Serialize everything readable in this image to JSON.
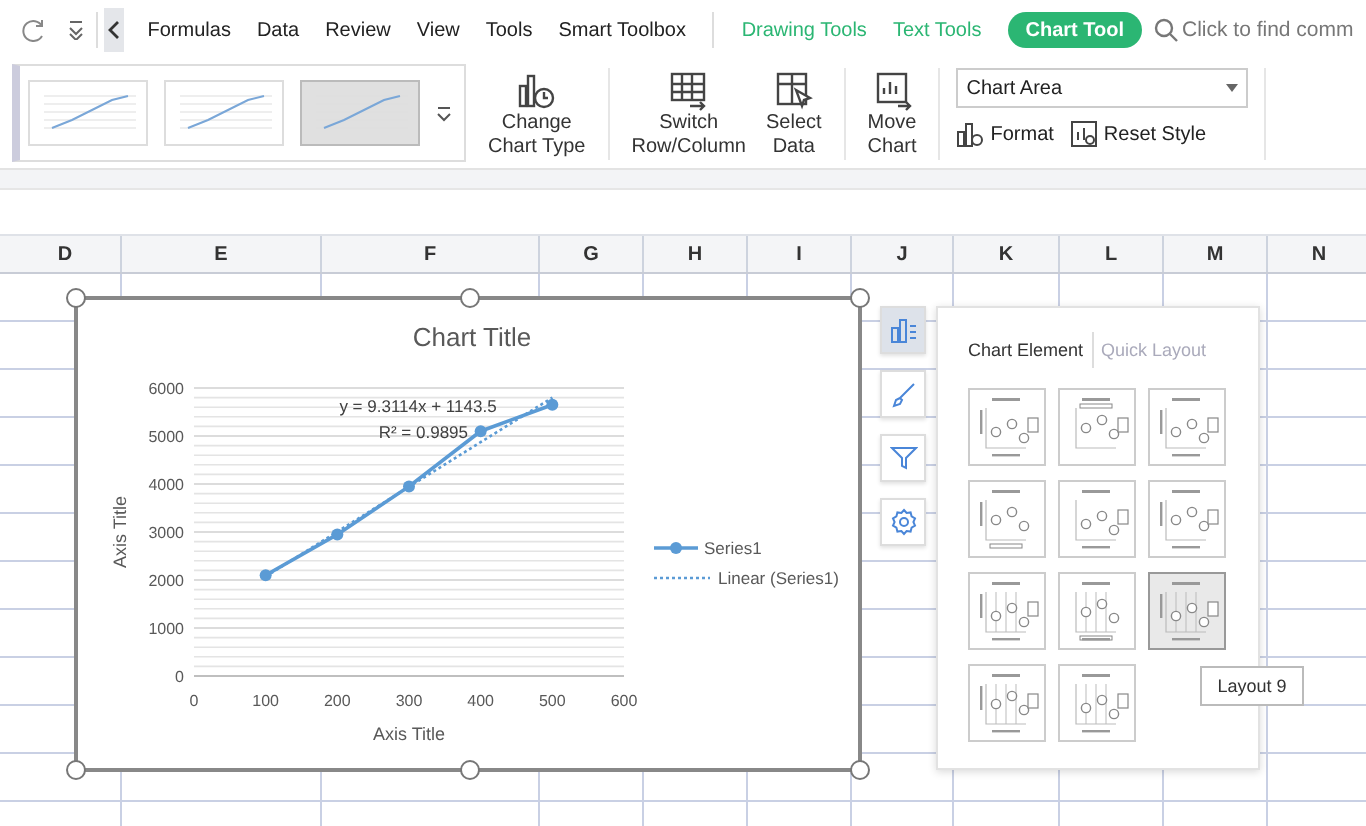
{
  "toolbar": {
    "tabs": [
      {
        "label": "Formulas",
        "kind": "menu",
        "selected": false
      },
      {
        "label": "Data",
        "kind": "menu",
        "selected": false
      },
      {
        "label": "Review",
        "kind": "menu",
        "selected": false
      },
      {
        "label": "View",
        "kind": "menu",
        "selected": false
      },
      {
        "label": "Tools",
        "kind": "menu",
        "selected": false
      },
      {
        "label": "Smart Toolbox",
        "kind": "menu",
        "selected": false
      },
      {
        "label": "Drawing Tools",
        "kind": "context",
        "selected": false
      },
      {
        "label": "Text Tools",
        "kind": "context",
        "selected": false
      },
      {
        "label": "Chart Tool",
        "kind": "context",
        "selected": true
      }
    ],
    "search": {
      "placeholder": "Click to find comm"
    }
  },
  "ribbon": {
    "chart_styles": [
      {
        "selected": false
      },
      {
        "selected": false
      },
      {
        "selected": true
      }
    ],
    "buttons": [
      {
        "kind": "change-type",
        "lines": [
          "Change",
          "Chart Type"
        ]
      },
      {
        "kind": "switch",
        "lines": [
          "Switch",
          "Row/Column"
        ]
      },
      {
        "kind": "select-data",
        "lines": [
          "Select",
          "Data"
        ]
      },
      {
        "kind": "move",
        "lines": [
          "Move",
          "Chart"
        ]
      }
    ],
    "element_select": {
      "value": "Chart Area"
    },
    "actions": [
      {
        "kind": "format",
        "label": "Format"
      },
      {
        "kind": "reset",
        "label": "Reset Style"
      }
    ]
  },
  "sheet": {
    "columns": [
      "D",
      "E",
      "F",
      "G",
      "H",
      "I",
      "J",
      "K",
      "L",
      "M",
      "N"
    ]
  },
  "chart": {
    "chart_data": {
      "type": "line",
      "title": "Chart Title",
      "xlabel": "Axis Title",
      "ylabel": "Axis Title",
      "x": [
        100,
        200,
        300,
        400,
        500
      ],
      "series": [
        {
          "name": "Series1",
          "color": "#5b9bd5",
          "marker": "circle",
          "line_style": "solid",
          "values": [
            2100,
            2950,
            3950,
            5100,
            5650
          ]
        },
        {
          "name": "Linear (Series1)",
          "color": "#5b9bd5",
          "line_style": "dotted",
          "values": [
            2070,
            3010,
            3940,
            4870,
            5800
          ]
        }
      ],
      "grid": true,
      "legend": true,
      "xlim": [
        0,
        600
      ],
      "ylim": [
        0,
        6000
      ],
      "xticks": [
        0,
        100,
        200,
        300,
        400,
        500,
        600
      ],
      "yticks": [
        0,
        1000,
        2000,
        3000,
        4000,
        5000,
        6000
      ],
      "annotations": [
        "y = 9.3114x + 1143.5",
        "R² = 0.9895"
      ]
    }
  },
  "side_buttons": [
    {
      "kind": "elements",
      "selected": true
    },
    {
      "kind": "style",
      "selected": false
    },
    {
      "kind": "filter",
      "selected": false
    },
    {
      "kind": "settings",
      "selected": false
    }
  ],
  "layout_panel": {
    "tabs": [
      {
        "label": "Chart Element",
        "selected": true
      },
      {
        "label": "Quick Layout",
        "selected": false
      }
    ],
    "layouts": [
      {
        "selected": false
      },
      {
        "selected": false
      },
      {
        "selected": false
      },
      {
        "selected": false
      },
      {
        "selected": false
      },
      {
        "selected": false
      },
      {
        "selected": false
      },
      {
        "selected": false
      },
      {
        "selected": true
      },
      {
        "selected": false
      },
      {
        "selected": false
      }
    ],
    "tooltip": "Layout 9"
  }
}
